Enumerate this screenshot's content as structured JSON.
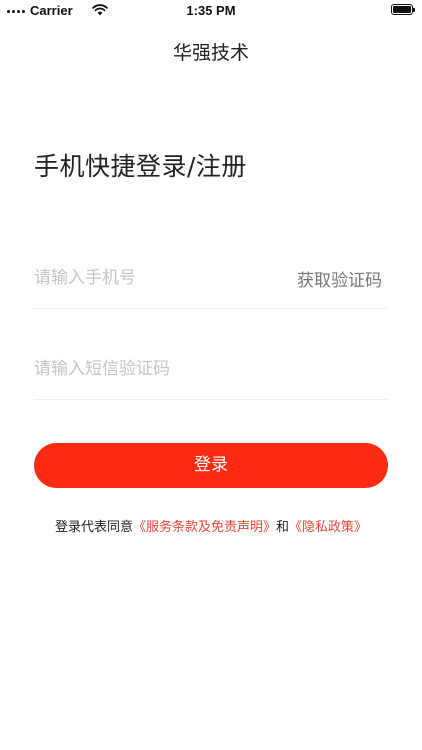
{
  "status_bar": {
    "carrier": "Carrier",
    "time": "1:35 PM",
    "battery_level": 1.0
  },
  "nav": {
    "title": "华强技术"
  },
  "login": {
    "title": "手机快捷登录/注册",
    "phone_placeholder": "请输入手机号",
    "get_code_label": "获取验证码",
    "code_placeholder": "请输入短信验证码",
    "submit_label": "登录"
  },
  "agreement": {
    "prefix": "登录代表同意",
    "terms_link": "《服务条款及免责声明》",
    "connector": "和",
    "privacy_link": "《隐私政策》"
  },
  "colors": {
    "accent": "#ff2a14",
    "link": "#e8473a",
    "placeholder": "#c4c4c4"
  },
  "icons": [
    "signal-dots-icon",
    "wifi-icon",
    "battery-icon"
  ]
}
